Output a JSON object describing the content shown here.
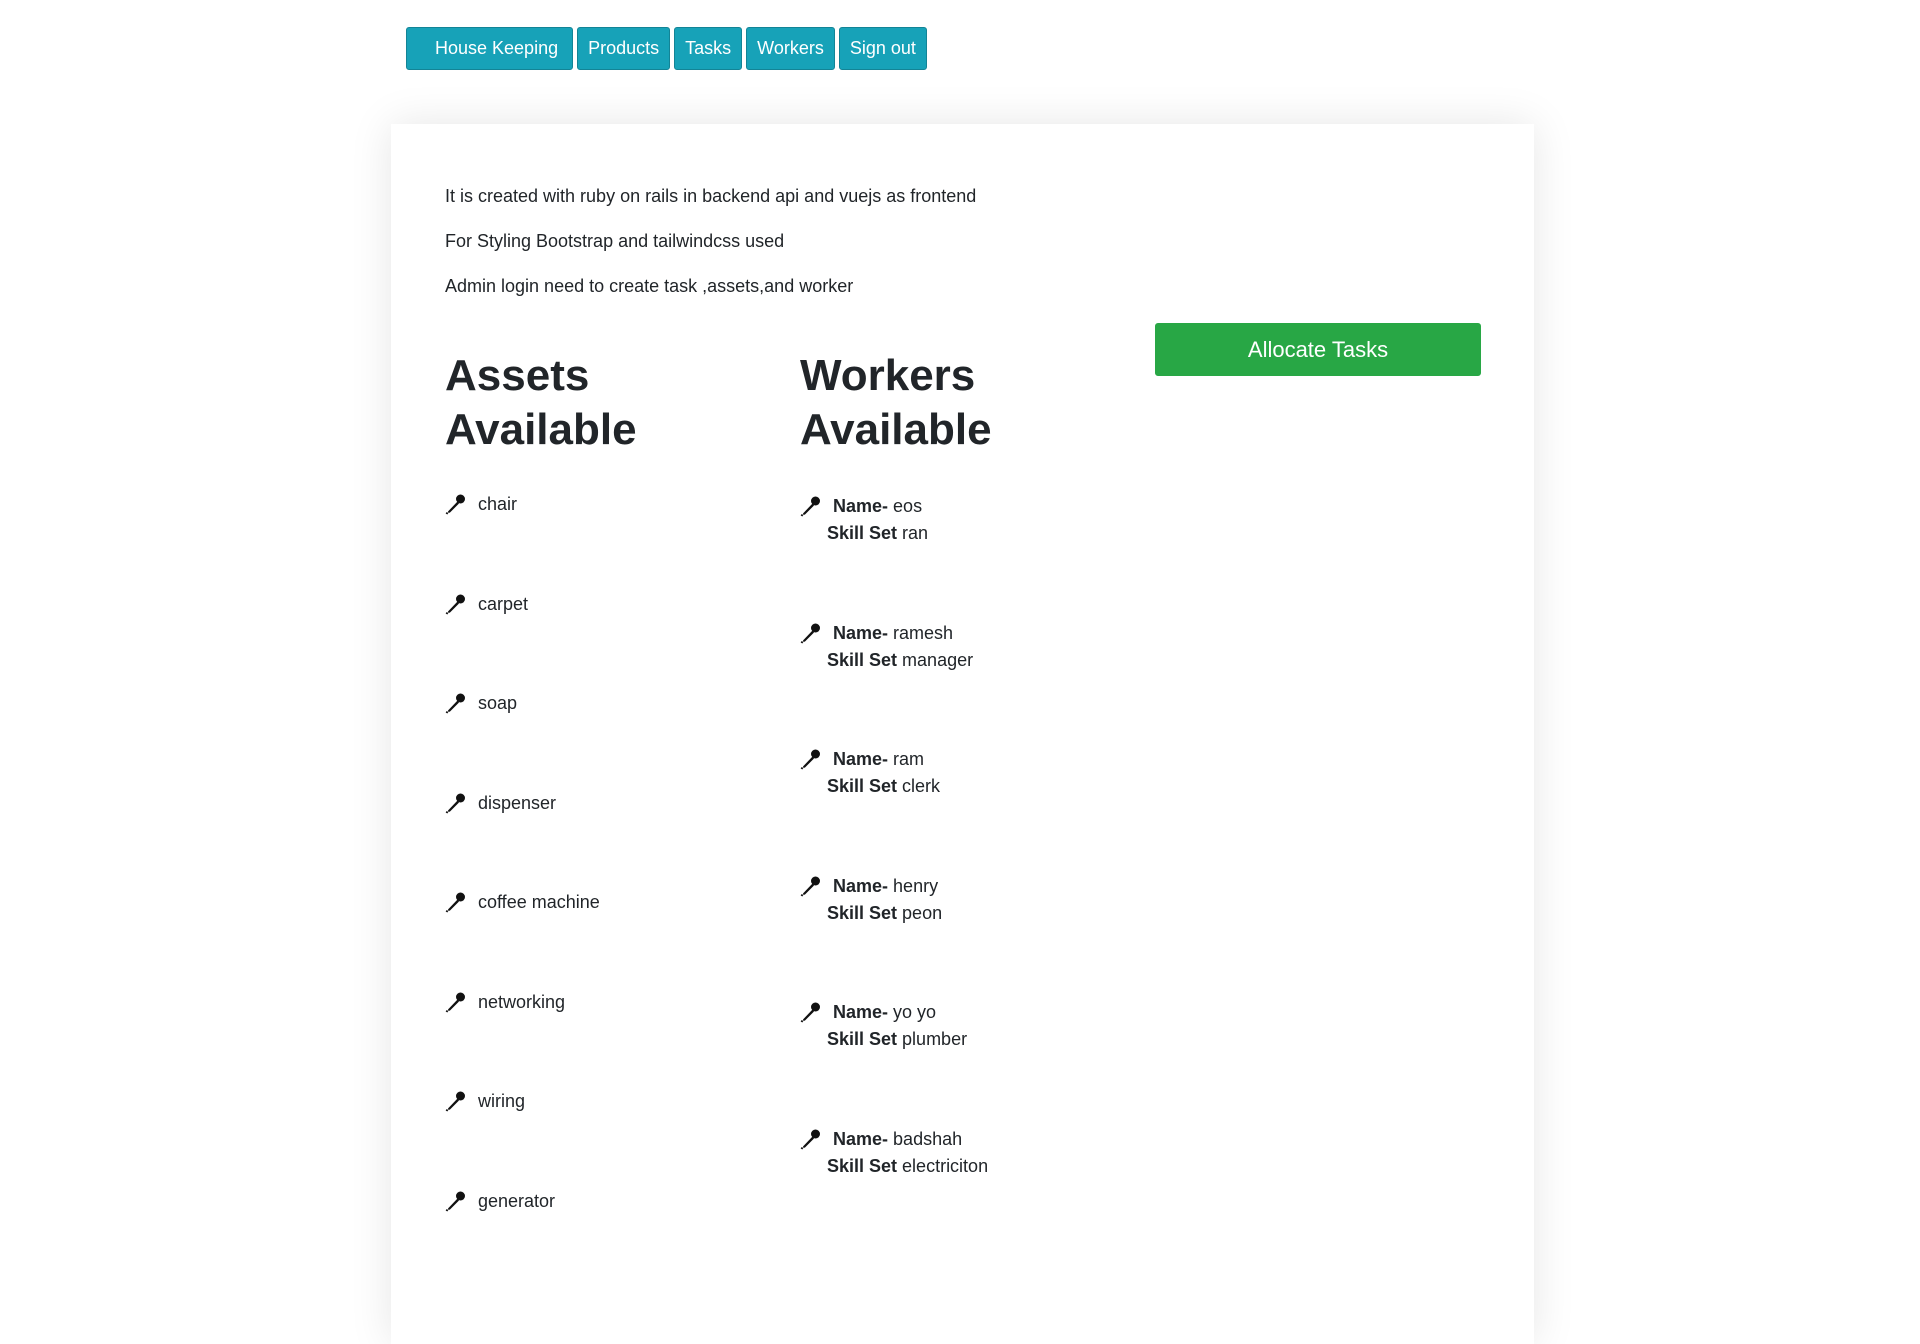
{
  "nav": {
    "items": [
      {
        "label": "House Keeping"
      },
      {
        "label": "Products"
      },
      {
        "label": "Tasks"
      },
      {
        "label": "Workers"
      },
      {
        "label": "Sign out"
      }
    ]
  },
  "intro": {
    "line1": "It is created with ruby on rails in backend api and vuejs as frontend",
    "line2": "For Styling Bootstrap and tailwindcss used",
    "line3": "Admin login need to create task ,assets,and worker"
  },
  "allocate_button": "Allocate Tasks",
  "assets": {
    "heading_line1": "Assets",
    "heading_line2": "Available",
    "icon": "pin-icon",
    "items": [
      "chair",
      "carpet",
      "soap",
      "dispenser",
      "coffee machine",
      "networking",
      "wiring",
      "generator"
    ]
  },
  "workers": {
    "heading_line1": "Workers",
    "heading_line2": "Available",
    "icon": "pin-icon",
    "name_label": "Name-",
    "skill_label": "Skill Set",
    "items": [
      {
        "name": "eos",
        "skill": "ran"
      },
      {
        "name": "ramesh",
        "skill": "manager"
      },
      {
        "name": "ram",
        "skill": "clerk"
      },
      {
        "name": "henry",
        "skill": "peon"
      },
      {
        "name": "yo yo",
        "skill": "plumber"
      },
      {
        "name": "badshah",
        "skill": "electriciton"
      }
    ]
  },
  "colors": {
    "nav_button": "#17a2b8",
    "allocate_button": "#28a745",
    "text": "#212529"
  }
}
